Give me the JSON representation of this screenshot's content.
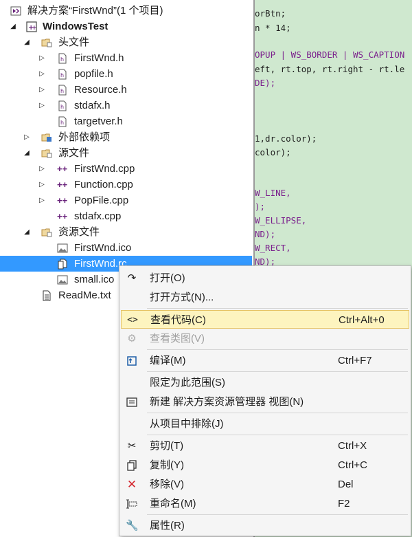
{
  "code_lines": [
    {
      "text": "orBtn;",
      "purple": false
    },
    {
      "text": "n * 14;",
      "purple": false
    },
    {
      "text": "OPUP | WS_BORDER | WS_CAPTION",
      "purple": true
    },
    {
      "text": "eft, rt.top, rt.right - rt.le",
      "purple": false
    },
    {
      "text": "DE);",
      "purple": true
    },
    {
      "text": "1,dr.color);",
      "purple": false
    },
    {
      "text": "color);",
      "purple": false
    },
    {
      "text": "W_LINE,",
      "purple": true
    },
    {
      "text": ");",
      "purple": true
    },
    {
      "text": "W_ELLIPSE,",
      "purple": true
    },
    {
      "text": "ND);",
      "purple": true
    },
    {
      "text": "W_RECT,",
      "purple": true
    },
    {
      "text": "ND);",
      "purple": true
    }
  ],
  "tree": {
    "solution_label": "解决方案“FirstWnd”(1 个项目)",
    "project_label": "WindowsTest",
    "headers_folder": "头文件",
    "headers": [
      "FirstWnd.h",
      "popfile.h",
      "Resource.h",
      "stdafx.h",
      "targetver.h"
    ],
    "external_deps": "外部依赖项",
    "sources_folder": "源文件",
    "sources": [
      "FirstWnd.cpp",
      "Function.cpp",
      "PopFile.cpp",
      "stdafx.cpp"
    ],
    "resources_folder": "资源文件",
    "resources": [
      "FirstWnd.ico",
      "FirstWnd.rc",
      "small.ico"
    ],
    "readme": "ReadMe.txt"
  },
  "menu": {
    "open": "打开(O)",
    "open_with": "打开方式(N)...",
    "view_code": "查看代码(C)",
    "view_code_key": "Ctrl+Alt+0",
    "view_class_diagram": "查看类图(V)",
    "compile": "编译(M)",
    "compile_key": "Ctrl+F7",
    "scope_to_this": "限定为此范围(S)",
    "new_view": "新建 解决方案资源管理器 视图(N)",
    "exclude": "从项目中排除(J)",
    "cut": "剪切(T)",
    "cut_key": "Ctrl+X",
    "copy": "复制(Y)",
    "copy_key": "Ctrl+C",
    "remove": "移除(V)",
    "remove_key": "Del",
    "rename": "重命名(M)",
    "rename_key": "F2",
    "properties": "属性(R)"
  },
  "colors": {
    "selection": "#3399ff",
    "editor_bg": "#cfe8cf",
    "menu_highlight": "#fdf4bf",
    "remove_icon": "#d4252d"
  }
}
